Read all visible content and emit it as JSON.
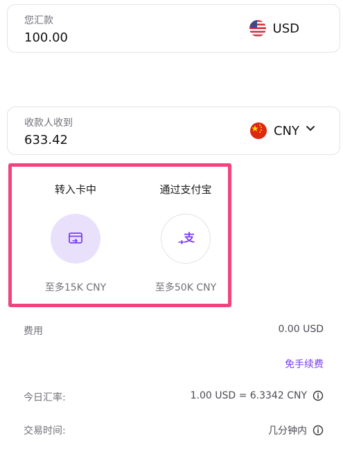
{
  "send": {
    "label": "您汇款",
    "amount": "100.00",
    "currency": "USD",
    "flag_icon": "us-flag-icon"
  },
  "receive": {
    "label": "收款人收到",
    "amount": "633.42",
    "currency": "CNY",
    "flag_icon": "cn-flag-icon"
  },
  "methods": [
    {
      "title": "转入卡中",
      "limit": "至多15K CNY",
      "icon": "card-transfer-icon",
      "selected": true
    },
    {
      "title": "通过支付宝",
      "limit": "至多50K CNY",
      "icon": "alipay-icon",
      "selected": false
    }
  ],
  "fees": {
    "label": "费用",
    "value": "0.00 USD",
    "note": "免手续费"
  },
  "rate": {
    "label": "今日汇率:",
    "value": "1.00 USD = 6.3342 CNY"
  },
  "time": {
    "label": "交易时间:",
    "value": "几分钟内"
  },
  "colors": {
    "accent": "#7a3cf0",
    "highlight_border": "#f2437e",
    "selected_bg": "#e9e1fc"
  }
}
